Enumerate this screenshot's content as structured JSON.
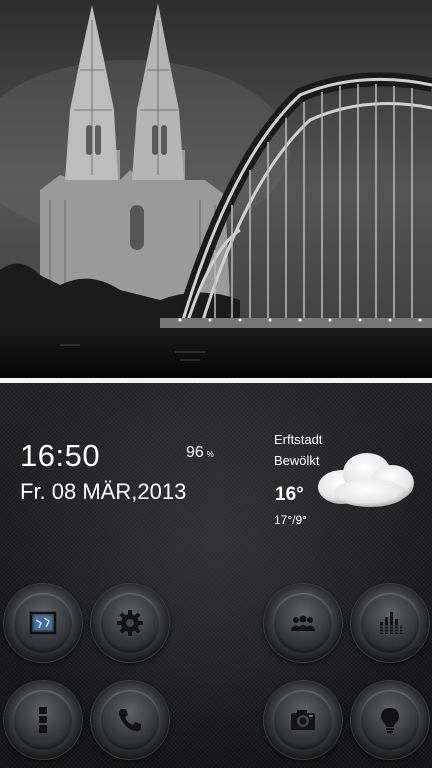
{
  "clock": {
    "time": "16:50",
    "date": "Fr. 08 MÄR,2013"
  },
  "battery": {
    "value": "96",
    "unit": "%"
  },
  "weather": {
    "city": "Erftstadt",
    "condition": "Bewölkt",
    "temperature": "16°",
    "range": "17°/9°",
    "icon": "cloud-icon"
  },
  "dock": [
    {
      "icon": "map-icon"
    },
    {
      "icon": "gear-icon"
    },
    {
      "icon": "contacts-icon"
    },
    {
      "icon": "equalizer-icon"
    },
    {
      "icon": "app-drawer-icon"
    },
    {
      "icon": "phone-icon"
    },
    {
      "icon": "camera-icon"
    },
    {
      "icon": "lightbulb-icon"
    }
  ],
  "colors": {
    "text": "#ffffff",
    "divider": "#f2f2f2",
    "background": "#141416"
  }
}
